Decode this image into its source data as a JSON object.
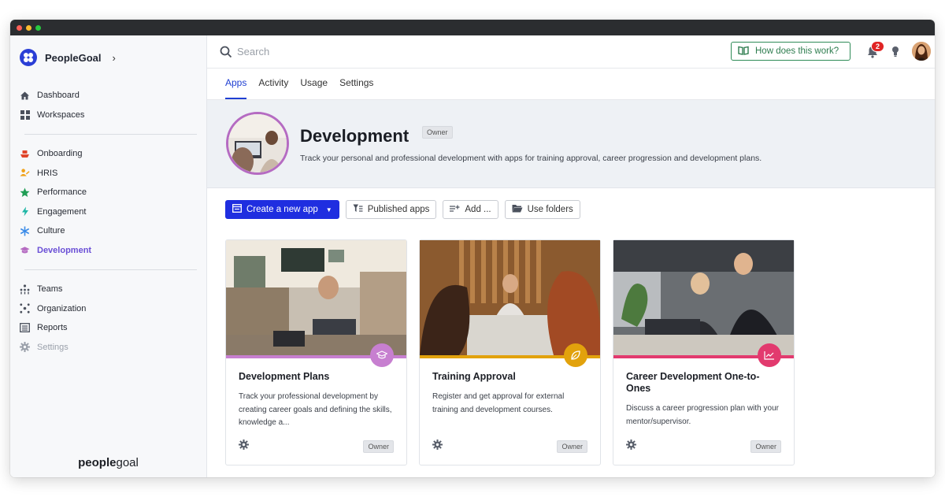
{
  "brand": {
    "name": "PeopleGoal"
  },
  "sidebar": {
    "primary": [
      {
        "label": "Dashboard",
        "icon": "home-icon"
      },
      {
        "label": "Workspaces",
        "icon": "grid-icon"
      }
    ],
    "apps": [
      {
        "label": "Onboarding",
        "icon": "ship-icon",
        "color": "#e0452a"
      },
      {
        "label": "HRIS",
        "icon": "people-icon",
        "color": "#f0a21a"
      },
      {
        "label": "Performance",
        "icon": "star-icon",
        "color": "#1f9d55"
      },
      {
        "label": "Engagement",
        "icon": "bolt-icon",
        "color": "#1fb6a6"
      },
      {
        "label": "Culture",
        "icon": "asterisk-icon",
        "color": "#3b8be8"
      },
      {
        "label": "Development",
        "icon": "graduation-cap-icon",
        "color": "#b56bc2"
      }
    ],
    "secondary": [
      {
        "label": "Teams",
        "icon": "teams-icon"
      },
      {
        "label": "Organization",
        "icon": "organization-icon"
      },
      {
        "label": "Reports",
        "icon": "reports-icon"
      },
      {
        "label": "Settings",
        "icon": "gear-icon"
      }
    ],
    "footer_bold": "people",
    "footer_light": "goal"
  },
  "topbar": {
    "search_placeholder": "Search",
    "how_label": "How does this work?",
    "notification_count": "2"
  },
  "tabs": [
    "Apps",
    "Activity",
    "Usage",
    "Settings"
  ],
  "hero": {
    "title": "Development",
    "badge": "Owner",
    "description": "Track your personal and professional development with apps for training approval, career progression and development plans."
  },
  "actions": {
    "create": "Create a new app",
    "published": "Published apps",
    "add": "Add ...",
    "folders": "Use folders"
  },
  "cards": [
    {
      "title": "Development Plans",
      "description": "Track your professional development by creating career goals and defining the skills, knowledge a...",
      "badge": "Owner",
      "accent": "#c77fd0",
      "icon": "graduation-cap-icon"
    },
    {
      "title": "Training Approval",
      "description": "Register and get approval for external training and development courses.",
      "badge": "Owner",
      "accent": "#e2a20c",
      "icon": "leaf-icon"
    },
    {
      "title": "Career Development One-to-Ones",
      "description": "Discuss a career progression plan with your mentor/supervisor.",
      "badge": "Owner",
      "accent": "#e23a6e",
      "icon": "chart-up-icon"
    }
  ]
}
